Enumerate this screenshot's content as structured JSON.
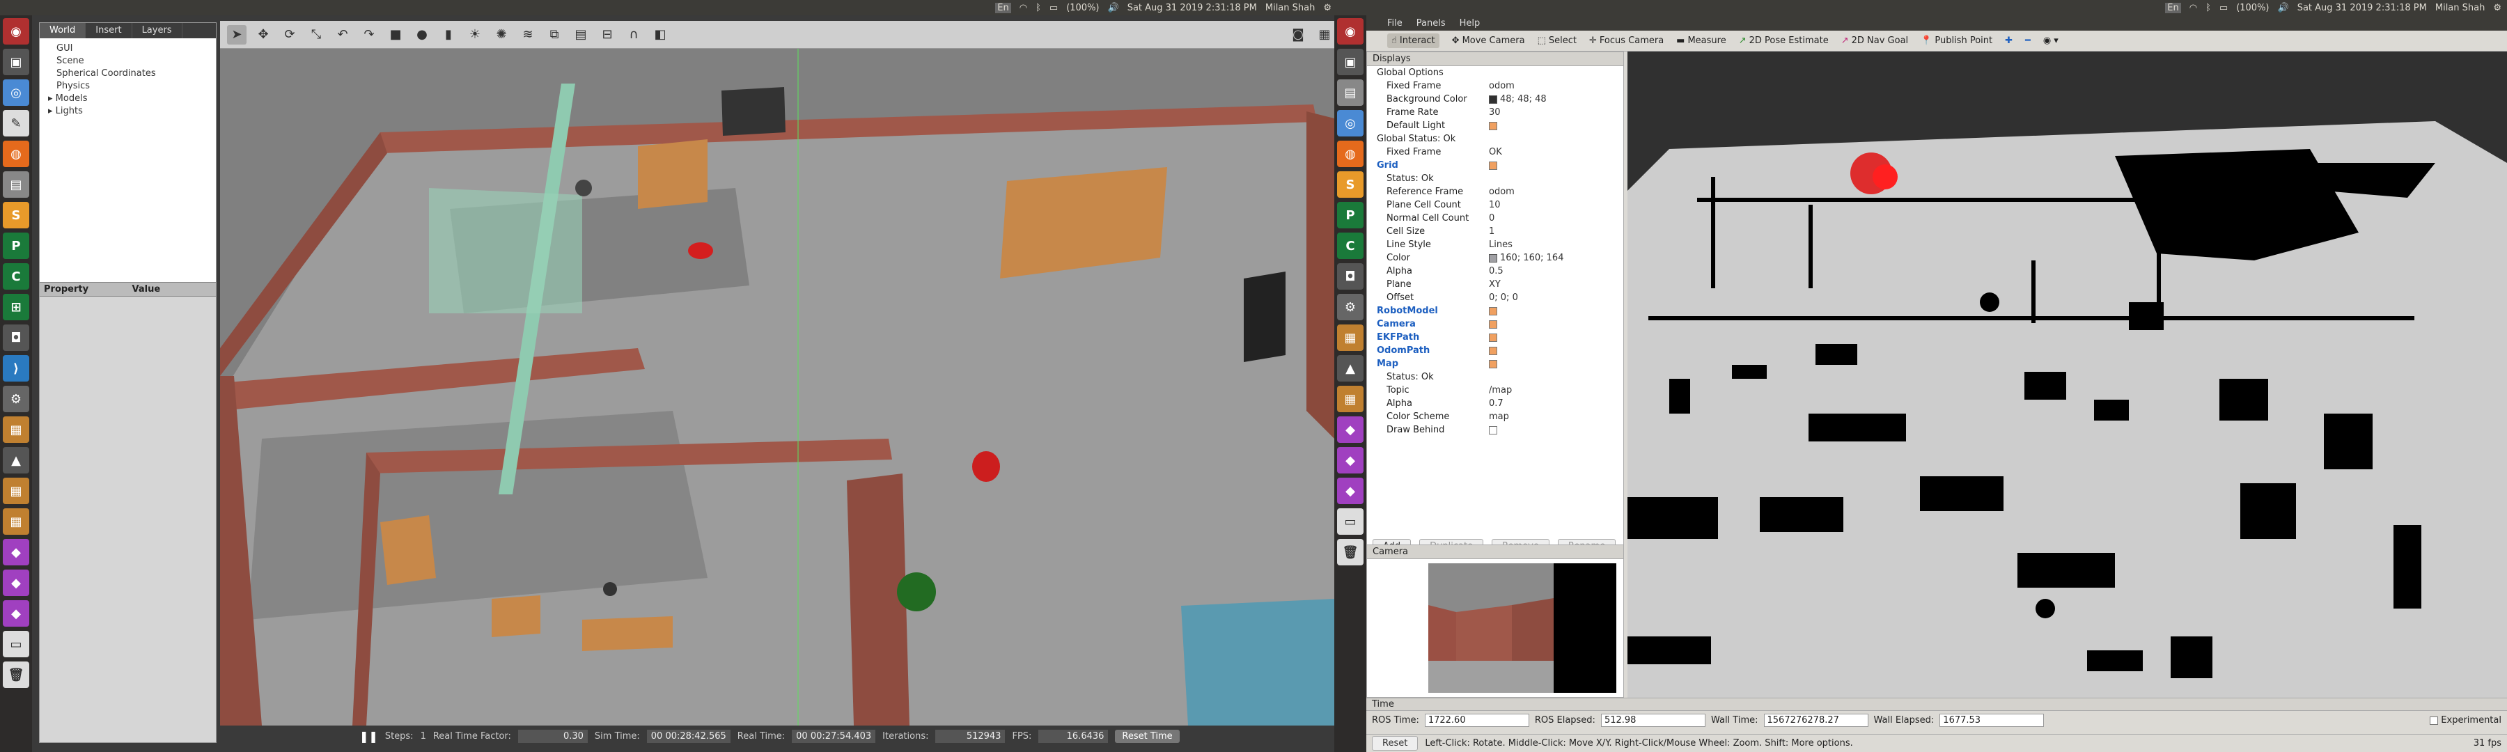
{
  "left_topbar": {
    "time": "Sat Aug 31 2019  2:31:18 PM",
    "user": "Milan Shah",
    "battery": "(100%)",
    "lang": "En"
  },
  "right_topbar": {
    "time": "Sat Aug 31 2019  2:31:18 PM",
    "user": "Milan Shah",
    "battery": "(100%)",
    "lang": "En"
  },
  "gazebo": {
    "tabs": [
      "World",
      "Insert",
      "Layers"
    ],
    "tree": [
      "GUI",
      "Scene",
      "Spherical Coordinates",
      "Physics",
      "Models",
      "Lights"
    ],
    "props_cols": [
      "Property",
      "Value"
    ],
    "bottom": {
      "steps_label": "Steps:",
      "steps_val": "1",
      "rtf_label": "Real Time Factor:",
      "rtf": "0.30",
      "sim_label": "Sim Time:",
      "sim": "00 00:28:42.565",
      "real_label": "Real Time:",
      "real": "00 00:27:54.403",
      "iter_label": "Iterations:",
      "iter": "512943",
      "fps_label": "FPS:",
      "fps": "16.6436",
      "reset": "Reset Time"
    }
  },
  "rviz": {
    "menu": [
      "File",
      "Panels",
      "Help"
    ],
    "tools": [
      "Interact",
      "Move Camera",
      "Select",
      "Focus Camera",
      "Measure",
      "2D Pose Estimate",
      "2D Nav Goal",
      "Publish Point"
    ],
    "displays_title": "Displays",
    "rows": [
      {
        "k": "Global Options",
        "v": "",
        "ind": 1,
        "cls": ""
      },
      {
        "k": "Fixed Frame",
        "v": "odom",
        "ind": 2,
        "cls": ""
      },
      {
        "k": "Background Color",
        "v": "48; 48; 48",
        "ind": 2,
        "cls": "",
        "swatch": "#303030"
      },
      {
        "k": "Frame Rate",
        "v": "30",
        "ind": 2,
        "cls": ""
      },
      {
        "k": "Default Light",
        "v": "",
        "ind": 2,
        "cls": "",
        "chk": true
      },
      {
        "k": "Global Status: Ok",
        "v": "",
        "ind": 1,
        "cls": ""
      },
      {
        "k": "Fixed Frame",
        "v": "OK",
        "ind": 2,
        "cls": ""
      },
      {
        "k": "Grid",
        "v": "",
        "ind": 1,
        "cls": "blue",
        "chk": true
      },
      {
        "k": "Status: Ok",
        "v": "",
        "ind": 2,
        "cls": ""
      },
      {
        "k": "Reference Frame",
        "v": "odom",
        "ind": 2,
        "cls": ""
      },
      {
        "k": "Plane Cell Count",
        "v": "10",
        "ind": 2,
        "cls": ""
      },
      {
        "k": "Normal Cell Count",
        "v": "0",
        "ind": 2,
        "cls": ""
      },
      {
        "k": "Cell Size",
        "v": "1",
        "ind": 2,
        "cls": ""
      },
      {
        "k": "Line Style",
        "v": "Lines",
        "ind": 2,
        "cls": ""
      },
      {
        "k": "Color",
        "v": "160; 160; 164",
        "ind": 2,
        "cls": "",
        "swatch": "#a0a0a4"
      },
      {
        "k": "Alpha",
        "v": "0.5",
        "ind": 2,
        "cls": ""
      },
      {
        "k": "Plane",
        "v": "XY",
        "ind": 2,
        "cls": ""
      },
      {
        "k": "Offset",
        "v": "0; 0; 0",
        "ind": 2,
        "cls": ""
      },
      {
        "k": "RobotModel",
        "v": "",
        "ind": 1,
        "cls": "blue",
        "chk": true
      },
      {
        "k": "Camera",
        "v": "",
        "ind": 1,
        "cls": "blue",
        "chk": true
      },
      {
        "k": "EKFPath",
        "v": "",
        "ind": 1,
        "cls": "blue",
        "chk": true
      },
      {
        "k": "OdomPath",
        "v": "",
        "ind": 1,
        "cls": "blue",
        "chk": true
      },
      {
        "k": "Map",
        "v": "",
        "ind": 1,
        "cls": "blue",
        "chk": true
      },
      {
        "k": "Status: Ok",
        "v": "",
        "ind": 2,
        "cls": ""
      },
      {
        "k": "Topic",
        "v": "/map",
        "ind": 2,
        "cls": ""
      },
      {
        "k": "Alpha",
        "v": "0.7",
        "ind": 2,
        "cls": ""
      },
      {
        "k": "Color Scheme",
        "v": "map",
        "ind": 2,
        "cls": ""
      },
      {
        "k": "Draw Behind",
        "v": "",
        "ind": 2,
        "cls": "",
        "chk": false
      }
    ],
    "buttons": [
      "Add",
      "Duplicate",
      "Remove",
      "Rename"
    ],
    "camera_title": "Camera",
    "time_title": "Time",
    "time": {
      "ros_time_label": "ROS Time:",
      "ros_time": "1722.60",
      "ros_elapsed_label": "ROS Elapsed:",
      "ros_elapsed": "512.98",
      "wall_time_label": "Wall Time:",
      "wall_time": "1567276278.27",
      "wall_elapsed_label": "Wall Elapsed:",
      "wall_elapsed": "1677.53",
      "experimental": "Experimental"
    },
    "status": {
      "reset": "Reset",
      "help": "Left-Click: Rotate. Middle-Click: Move X/Y. Right-Click/Mouse Wheel: Zoom. Shift: More options.",
      "fps": "31 fps"
    }
  }
}
